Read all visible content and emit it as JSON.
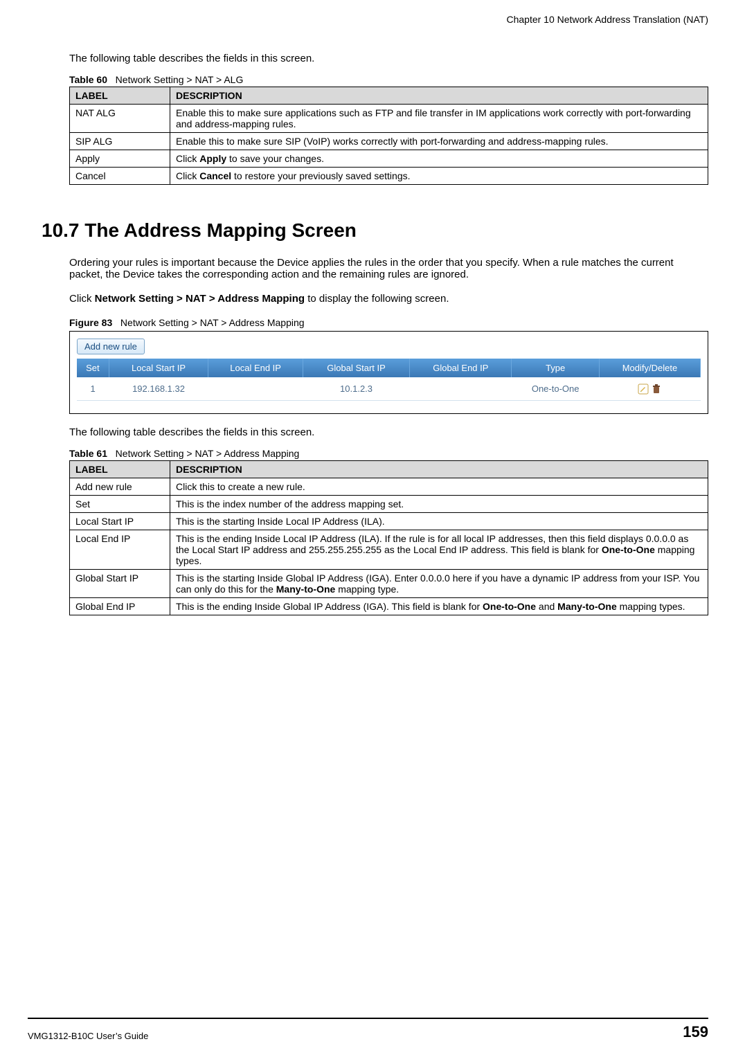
{
  "chapter_header": "Chapter 10 Network Address Translation (NAT)",
  "intro1": "The following table describes the fields in this screen.",
  "table60": {
    "caption_prefix": "Table 60",
    "caption_text": "Network Setting > NAT > ALG",
    "head_label": "LABEL",
    "head_desc": "DESCRIPTION",
    "rows": [
      {
        "label": "NAT ALG",
        "desc": "Enable this to make sure applications such as FTP and file transfer in IM applications work correctly with port-forwarding and address-mapping rules."
      },
      {
        "label": "SIP ALG",
        "desc": "Enable this to make sure SIP (VoIP) works correctly with port-forwarding and address-mapping rules."
      },
      {
        "label": "Apply",
        "desc_pre": "Click ",
        "desc_bold": "Apply",
        "desc_post": " to save your changes."
      },
      {
        "label": "Cancel",
        "desc_pre": "Click ",
        "desc_bold": "Cancel",
        "desc_post": " to restore your previously saved settings."
      }
    ]
  },
  "section_heading": "10.7  The Address Mapping Screen",
  "para1": "Ordering your rules is important because the Device applies the rules in the order that you specify. When a rule matches the current packet, the Device takes the corresponding action and the remaining rules are ignored.",
  "para2_pre": "Click ",
  "para2_bold": "Network Setting > NAT > Address Mapping",
  "para2_post": " to display the following screen.",
  "figure83": {
    "caption_prefix": "Figure 83",
    "caption_text": "Network Setting > NAT > Address Mapping",
    "add_button": "Add new rule",
    "columns": [
      "Set",
      "Local Start IP",
      "Local End IP",
      "Global Start IP",
      "Global End IP",
      "Type",
      "Modify/Delete"
    ],
    "row": {
      "set": "1",
      "local_start": "192.168.1.32",
      "local_end": "",
      "global_start": "10.1.2.3",
      "global_end": "",
      "type": "One-to-One"
    }
  },
  "intro2": "The following table describes the fields in this screen.",
  "table61": {
    "caption_prefix": "Table 61",
    "caption_text": "Network Setting > NAT > Address Mapping",
    "head_label": "LABEL",
    "head_desc": "DESCRIPTION",
    "rows": [
      {
        "label": "Add new rule",
        "desc": "Click this to create a new rule."
      },
      {
        "label": "Set",
        "desc": "This is the index number of the address mapping set."
      },
      {
        "label": "Local Start IP",
        "desc": "This is the starting Inside Local IP Address (ILA)."
      },
      {
        "label": "Local End IP",
        "desc_full_segments": [
          "This is the ending Inside Local IP Address (ILA). If the rule is for all local IP addresses, then this field displays 0.0.0.0 as the Local Start IP address and 255.255.255.255 as the Local End IP address. This field is blank for ",
          [
            "b",
            "One-to-One"
          ],
          " mapping types."
        ]
      },
      {
        "label": "Global Start IP",
        "desc_full_segments": [
          "This is the starting Inside Global IP Address (IGA). Enter 0.0.0.0 here if you have a dynamic IP address from your ISP. You can only do this for the ",
          [
            "b",
            "Many-to-One"
          ],
          " mapping type."
        ]
      },
      {
        "label": "Global End IP",
        "desc_full_segments": [
          "This is the ending Inside Global IP Address (IGA). This field is blank for ",
          [
            "b",
            "One-to-One"
          ],
          " and ",
          [
            "b",
            "Many-to-One"
          ],
          " mapping types."
        ]
      }
    ]
  },
  "footer": {
    "guide": "VMG1312-B10C User’s Guide",
    "page": "159"
  }
}
